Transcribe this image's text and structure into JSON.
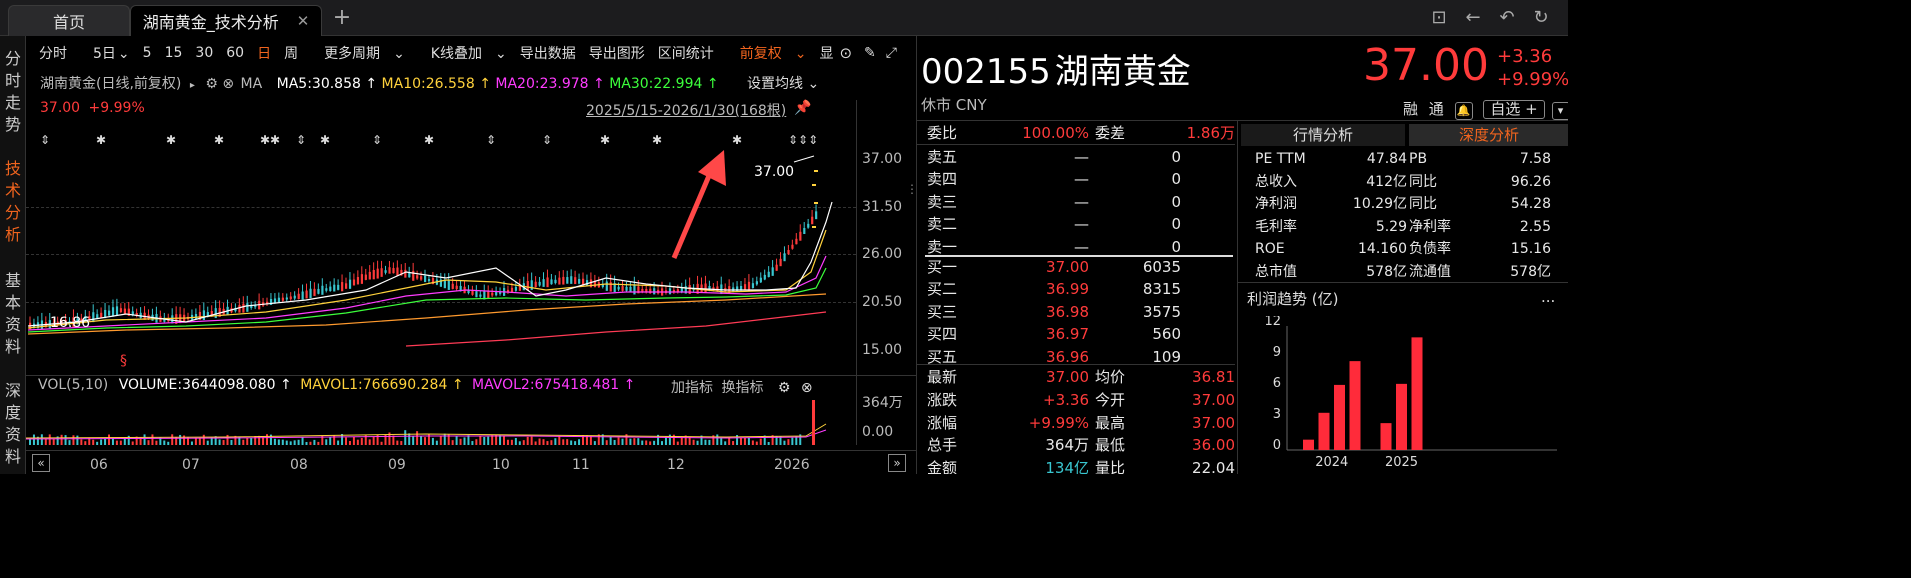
{
  "tabs": {
    "home": "首页",
    "active": "湖南黄金_技术分析",
    "add": "+",
    "close": "✕"
  },
  "left_tabs": [
    "分时走势",
    "技术分析",
    "基本资料",
    "深度资料"
  ],
  "toolbar": {
    "items": [
      "分时",
      "5日",
      "5",
      "15",
      "30",
      "60",
      "日",
      "周",
      "更多周期",
      "K线叠加",
      "导出数据",
      "导出图形",
      "区间统计",
      "前复权",
      "显"
    ]
  },
  "chart": {
    "series_name": "湖南黄金(日线,前复权)",
    "ma_label": "MA",
    "ma5": "MA5:30.858",
    "ma10": "MA10:26.558",
    "ma20": "MA20:23.978",
    "ma30": "MA30:22.994",
    "set_ma": "设置均线",
    "last_price": "37.00",
    "last_change": "+9.99%",
    "range": "2025/5/15-2026/1/30(168根)",
    "high_label": "37.00",
    "low_label": "16.86",
    "yticks": [
      "37.00",
      "31.50",
      "26.00",
      "20.50",
      "15.00"
    ],
    "xticks": [
      "06",
      "07",
      "08",
      "09",
      "10",
      "11",
      "12",
      "2026"
    ],
    "vol_label": "VOL(5,10)",
    "volume": "VOLUME:3644098.080",
    "mavol1": "MAVOL1:766690.284",
    "mavol2": "MAVOL2:675418.481",
    "add_indicator": "加指标",
    "switch_indicator": "换指标",
    "vol_yticks": [
      "364万",
      "0.00"
    ],
    "colors": {
      "ma5": "#ffffff",
      "ma10": "#ffd23c",
      "ma20": "#ff3cff",
      "ma30": "#3cff3c",
      "up": "#ff3b3b",
      "down": "#39c6d0",
      "arrow": "#ff4848"
    }
  },
  "quote": {
    "code": "002155",
    "name": "湖南黄金",
    "status": "休市 CNY",
    "price": "37.00",
    "change": "+3.36",
    "change_pct": "+9.99%",
    "rong": "融",
    "tong": "通",
    "zixuan": "自选 +",
    "weibi_label": "委比",
    "weibi": "100.00%",
    "weicha_label": "委差",
    "weicha": "1.86万",
    "asks": [
      {
        "label": "卖五",
        "price": "—",
        "vol": "0"
      },
      {
        "label": "卖四",
        "price": "—",
        "vol": "0"
      },
      {
        "label": "卖三",
        "price": "—",
        "vol": "0"
      },
      {
        "label": "卖二",
        "price": "—",
        "vol": "0"
      },
      {
        "label": "卖一",
        "price": "—",
        "vol": "0"
      }
    ],
    "bids": [
      {
        "label": "买一",
        "price": "37.00",
        "vol": "6035"
      },
      {
        "label": "买二",
        "price": "36.99",
        "vol": "8315"
      },
      {
        "label": "买三",
        "price": "36.98",
        "vol": "3575"
      },
      {
        "label": "买四",
        "price": "36.97",
        "vol": "560"
      },
      {
        "label": "买五",
        "price": "36.96",
        "vol": "109"
      }
    ],
    "stats": [
      {
        "l1": "最新",
        "v1": "37.00",
        "c1": "red",
        "l2": "均价",
        "v2": "36.81",
        "c2": "red"
      },
      {
        "l1": "涨跌",
        "v1": "+3.36",
        "c1": "red",
        "l2": "今开",
        "v2": "37.00",
        "c2": "red"
      },
      {
        "l1": "涨幅",
        "v1": "+9.99%",
        "c1": "red",
        "l2": "最高",
        "v2": "37.00",
        "c2": "red"
      },
      {
        "l1": "总手",
        "v1": "364万",
        "c1": "white",
        "l2": "最低",
        "v2": "36.00",
        "c2": "red"
      },
      {
        "l1": "金额",
        "v1": "134亿",
        "c1": "cyan",
        "l2": "量比",
        "v2": "22.04",
        "c2": "white"
      }
    ]
  },
  "analysis": {
    "tab1": "行情分析",
    "tab2": "深度分析",
    "fin": [
      {
        "l1": "PE TTM",
        "v1": "47.84",
        "l2": "PB",
        "v2": "7.58"
      },
      {
        "l1": "总收入",
        "v1": "412亿",
        "l2": "同比",
        "v2": "96.26"
      },
      {
        "l1": "净利润",
        "v1": "10.29亿",
        "l2": "同比",
        "v2": "54.28"
      },
      {
        "l1": "毛利率",
        "v1": "5.29",
        "l2": "净利率",
        "v2": "2.55"
      },
      {
        "l1": "ROE",
        "v1": "14.160",
        "l2": "负债率",
        "v2": "15.16"
      },
      {
        "l1": "总市值",
        "v1": "578亿",
        "l2": "流通值",
        "v2": "578亿"
      }
    ],
    "profit_title": "利润趋势 (亿)",
    "more": "..."
  },
  "chart_data": {
    "type": "bar",
    "title": "利润趋势 (亿)",
    "categories": [
      "2024",
      "2025"
    ],
    "ylim": [
      0,
      12
    ],
    "yticks": [
      "12",
      "9",
      "6",
      "3",
      "0"
    ],
    "series": [
      {
        "values": [
          1.0,
          3.6,
          6.3,
          8.6,
          null,
          2.6,
          6.4,
          10.9
        ]
      }
    ]
  }
}
